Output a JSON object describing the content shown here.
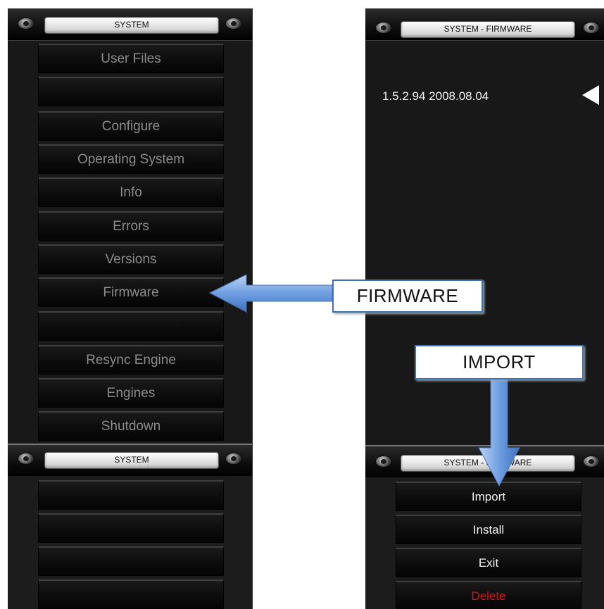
{
  "left_panel": {
    "title": "SYSTEM",
    "menu_items": [
      "User Files",
      "",
      "Configure",
      "Operating System",
      "Info",
      "Errors",
      "Versions",
      "Firmware",
      "",
      "Resync Engine",
      "Engines",
      "Shutdown"
    ],
    "lower_title": "SYSTEM",
    "lower_items": [
      "",
      "",
      "",
      ""
    ]
  },
  "right_panel": {
    "title": "SYSTEM - FIRMWARE",
    "firmware_version": "1.5.2.94 2008.08.04",
    "lower_title": "SYSTEM - FIRMWARE",
    "buttons": [
      "Import",
      "Install",
      "Exit",
      "Delete"
    ]
  },
  "callouts": {
    "firmware": "FIRMWARE",
    "import": "IMPORT"
  },
  "colors": {
    "panel_bg": "#181818",
    "menu_text_dim": "#8b8b8b",
    "menu_text_bright": "#f2f2f2",
    "delete_text": "#e01010",
    "arrow_blue": "#5b8fd8"
  },
  "icons": [
    "knob-icon",
    "back-arrow-icon",
    "pointer-arrow-icon"
  ]
}
